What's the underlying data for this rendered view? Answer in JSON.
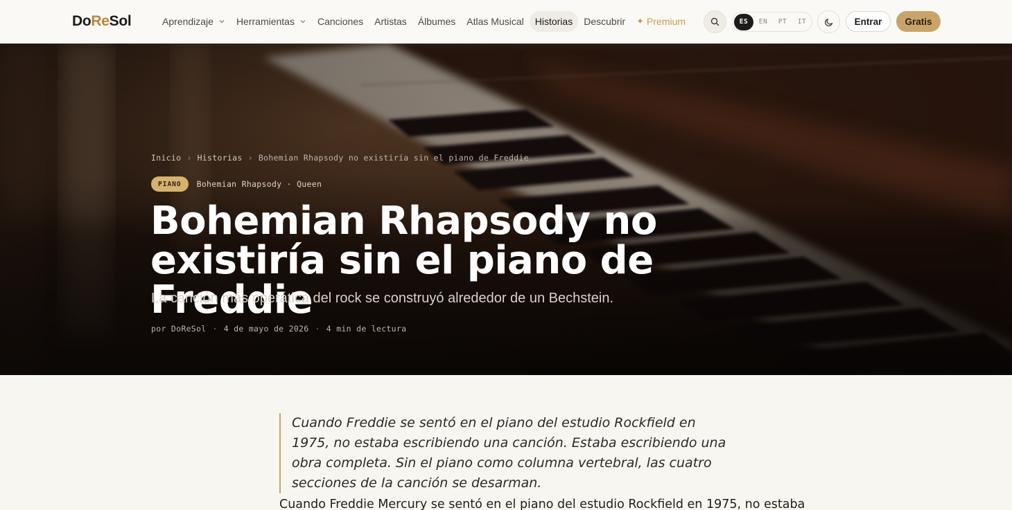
{
  "brand": {
    "part1": "Do",
    "part2": "Re",
    "part3": "Sol"
  },
  "nav": {
    "items": [
      {
        "label": "Aprendizaje",
        "dropdown": true
      },
      {
        "label": "Herramientas",
        "dropdown": true
      },
      {
        "label": "Canciones"
      },
      {
        "label": "Artistas"
      },
      {
        "label": "Álbumes"
      },
      {
        "label": "Atlas Musical"
      },
      {
        "label": "Historias",
        "active": true
      },
      {
        "label": "Descubrir"
      }
    ],
    "premium": {
      "icon": "sparkle-icon",
      "label": "Premium"
    },
    "languages": [
      "ES",
      "EN",
      "PT",
      "IT"
    ],
    "active_language": "ES",
    "login_label": "Entrar",
    "signup_label": "Gratis"
  },
  "hero": {
    "breadcrumb": {
      "home": "Inicio",
      "section": "Historias",
      "current": "Bohemian Rhapsody no existiría sin el piano de Freddie"
    },
    "badge": "PIANO",
    "song_meta": "Bohemian Rhapsody · Queen",
    "title": "Bohemian Rhapsody no existiría sin el piano de Freddie",
    "subtitle": "La canción más operática del rock se construyó alrededor de un Bechstein.",
    "author": "por DoReSol",
    "date": "4 de mayo de 2026",
    "read_time": "4 min de lectura"
  },
  "article": {
    "pullquote": "Cuando Freddie se sentó en el piano del estudio Rockfield en 1975, no estaba escribiendo una canción. Estaba escribiendo una obra completa. Sin el piano como columna vertebral, las cuatro secciones de la canción se desarman.",
    "first_paragraph": "Cuando Freddie Mercury se sentó en el piano del estudio Rockfield en 1975, no estaba"
  },
  "colors": {
    "accent": "#c9a46a",
    "badge": "#d7b26f",
    "dark": "#1d1c1a",
    "page_bg": "#f8f6f1"
  }
}
